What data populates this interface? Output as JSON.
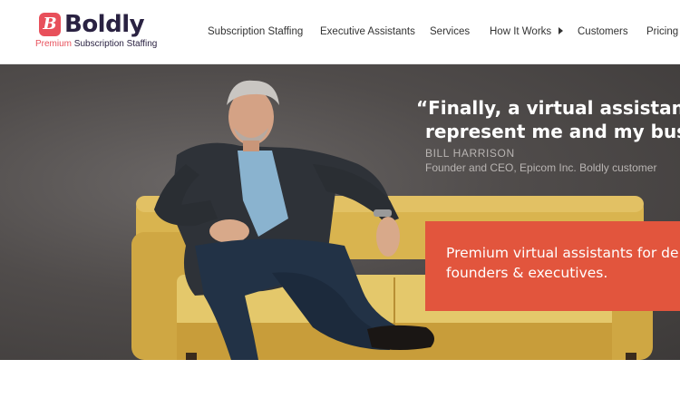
{
  "logo": {
    "mark": "B",
    "name": "Boldly",
    "tag_accent": "Premium",
    "tag_rest": " Subscription Staffing"
  },
  "nav": {
    "items": [
      {
        "label": "Subscription Staffing"
      },
      {
        "label": "Executive Assistants"
      },
      {
        "label": "Services"
      },
      {
        "label": "How It Works"
      },
      {
        "label": "Customers"
      },
      {
        "label": "Pricing"
      }
    ]
  },
  "hero": {
    "quote_line1": "“Finally, a virtual assistant I t",
    "quote_line2": "represent me and my busine",
    "attribution_name": "BILL HARRISON",
    "attribution_role": "Founder and CEO, Epicom Inc. Boldly customer",
    "cta_line1": "Premium virtual assistants for de",
    "cta_line2": "founders & executives."
  },
  "colors": {
    "brand_red": "#e8505b",
    "brand_navy": "#2a2242",
    "cta_orange": "#e2553d"
  },
  "icons": {
    "nav_caret": "caret-right-icon"
  }
}
